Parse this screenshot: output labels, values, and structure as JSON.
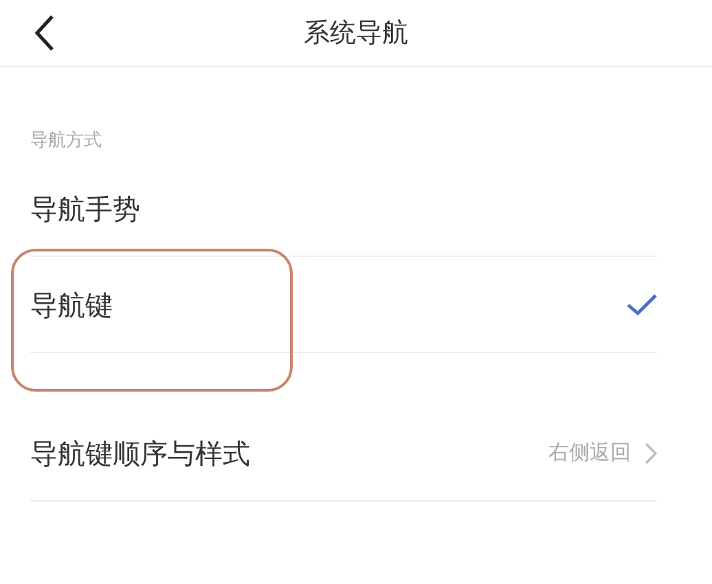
{
  "header": {
    "title": "系统导航"
  },
  "section": {
    "label": "导航方式"
  },
  "options": [
    {
      "label": "导航手势",
      "selected": false,
      "annotated": false
    },
    {
      "label": "导航键",
      "selected": true,
      "annotated": true
    }
  ],
  "settings": [
    {
      "label": "导航键顺序与样式",
      "value": "右侧返回"
    }
  ]
}
